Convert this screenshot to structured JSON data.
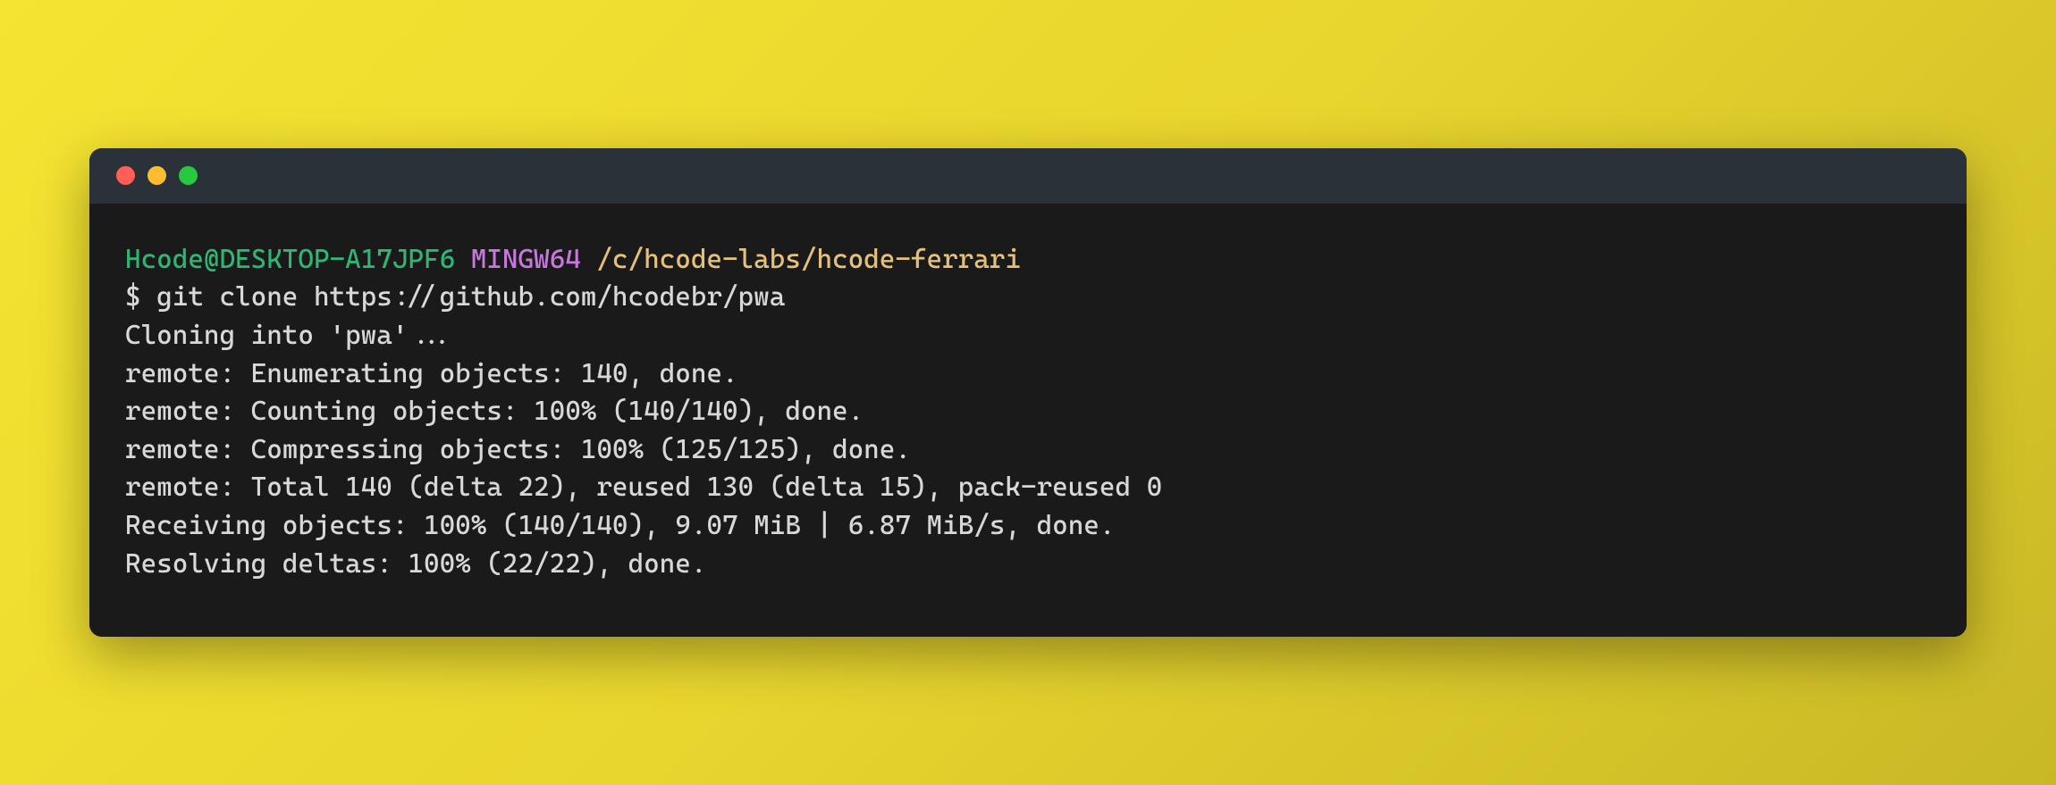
{
  "prompt": {
    "user_host": "Hcode@DESKTOP-A17JPF6",
    "env": "MINGW64",
    "path": "/c/hcode-labs/hcode-ferrari",
    "symbol": "$",
    "command": "git clone https://github.com/hcodebr/pwa"
  },
  "output": {
    "line1": "Cloning into 'pwa'...",
    "line2": "remote: Enumerating objects: 140, done.",
    "line3": "remote: Counting objects: 100% (140/140), done.",
    "line4": "remote: Compressing objects: 100% (125/125), done.",
    "line5": "remote: Total 140 (delta 22), reused 130 (delta 15), pack-reused 0",
    "line6": "Receiving objects: 100% (140/140), 9.07 MiB | 6.87 MiB/s, done.",
    "line7": "Resolving deltas: 100% (22/22), done."
  }
}
